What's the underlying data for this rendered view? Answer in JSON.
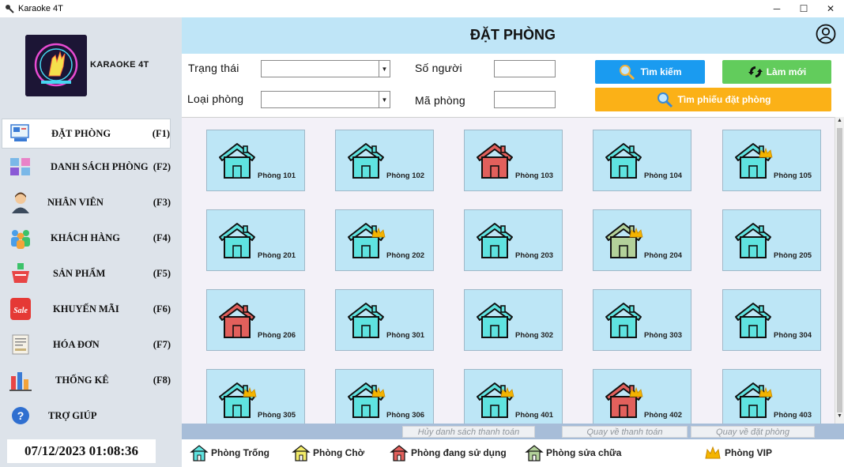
{
  "window": {
    "title": "Karaoke 4T",
    "minimize": "─",
    "maximize": "☐",
    "close": "✕"
  },
  "brand": {
    "name": "KARAOKE 4T"
  },
  "menu": [
    {
      "label": "ĐẶT PHÒNG",
      "key": "(F1)",
      "icon": "booking-icon"
    },
    {
      "label": "DANH SÁCH PHÒNG",
      "key": "(F2)",
      "icon": "room-list-icon"
    },
    {
      "label": "NHÂN VIÊN",
      "key": "(F3)",
      "icon": "employee-icon"
    },
    {
      "label": "KHÁCH HÀNG",
      "key": "(F4)",
      "icon": "customers-icon"
    },
    {
      "label": "SẢN PHẨM",
      "key": "(F5)",
      "icon": "product-basket-icon"
    },
    {
      "label": "KHUYẾN MÃI",
      "key": "(F6)",
      "icon": "sale-icon"
    },
    {
      "label": "HÓA ĐƠN",
      "key": "(F7)",
      "icon": "invoice-icon"
    },
    {
      "label": "THỐNG KÊ",
      "key": "(F8)",
      "icon": "statistics-icon"
    },
    {
      "label": "TRỢ GIÚP",
      "key": "",
      "icon": "help-icon"
    }
  ],
  "clock": "07/12/2023 01:08:36",
  "page_title": "ĐẶT PHÒNG",
  "filters": {
    "status_label": "Trạng thái",
    "status_value": "",
    "type_label": "Loại phòng",
    "type_value": "",
    "people_label": "Số người",
    "people_value": "",
    "room_code_label": "Mã phòng",
    "room_code_value": ""
  },
  "buttons": {
    "search": "Tìm kiếm",
    "refresh": "Làm mới",
    "find_booking": "Tìm phiếu đặt phòng"
  },
  "rooms": [
    {
      "label": "Phòng 101",
      "status": "available",
      "vip": false
    },
    {
      "label": "Phòng 102",
      "status": "available",
      "vip": false
    },
    {
      "label": "Phòng 103",
      "status": "in-use",
      "vip": false
    },
    {
      "label": "Phòng 104",
      "status": "available",
      "vip": false
    },
    {
      "label": "Phòng 105",
      "status": "available",
      "vip": true
    },
    {
      "label": "Phòng 201",
      "status": "available",
      "vip": false
    },
    {
      "label": "Phòng 202",
      "status": "available",
      "vip": true
    },
    {
      "label": "Phòng 203",
      "status": "available",
      "vip": false
    },
    {
      "label": "Phòng 204",
      "status": "repair",
      "vip": true
    },
    {
      "label": "Phòng 205",
      "status": "available",
      "vip": false
    },
    {
      "label": "Phòng 206",
      "status": "in-use",
      "vip": false
    },
    {
      "label": "Phòng 301",
      "status": "available",
      "vip": false
    },
    {
      "label": "Phòng 302",
      "status": "available",
      "vip": false
    },
    {
      "label": "Phòng 303",
      "status": "available",
      "vip": false
    },
    {
      "label": "Phòng 304",
      "status": "available",
      "vip": false
    },
    {
      "label": "Phòng 305",
      "status": "available",
      "vip": true
    },
    {
      "label": "Phòng 306",
      "status": "available",
      "vip": true
    },
    {
      "label": "Phòng 401",
      "status": "available",
      "vip": true
    },
    {
      "label": "Phòng 402",
      "status": "in-use",
      "vip": true
    },
    {
      "label": "Phòng 403",
      "status": "available",
      "vip": true
    }
  ],
  "actions": {
    "cancel_payment_list": "Hủy danh sách thanh toán",
    "back_to_payment": "Quay về thanh toán",
    "back_to_booking": "Quay về đặt phòng"
  },
  "legend": {
    "available": "Phòng Trống",
    "waiting": "Phòng Chờ",
    "in_use": "Phòng đang sử dụng",
    "repair": "Phòng sửa chữa",
    "vip": "Phòng VIP"
  },
  "colors": {
    "available": "#5fe3e0",
    "waiting": "#f3ec6a",
    "in_use": "#e2605c",
    "repair": "#b3d19a",
    "vip": "#f4b400",
    "search_button": "#1a9bf0",
    "refresh_button": "#62cc5c",
    "find_booking_button": "#fbb117",
    "header": "#bfe5f7",
    "room_tile": "#bde6f6"
  }
}
